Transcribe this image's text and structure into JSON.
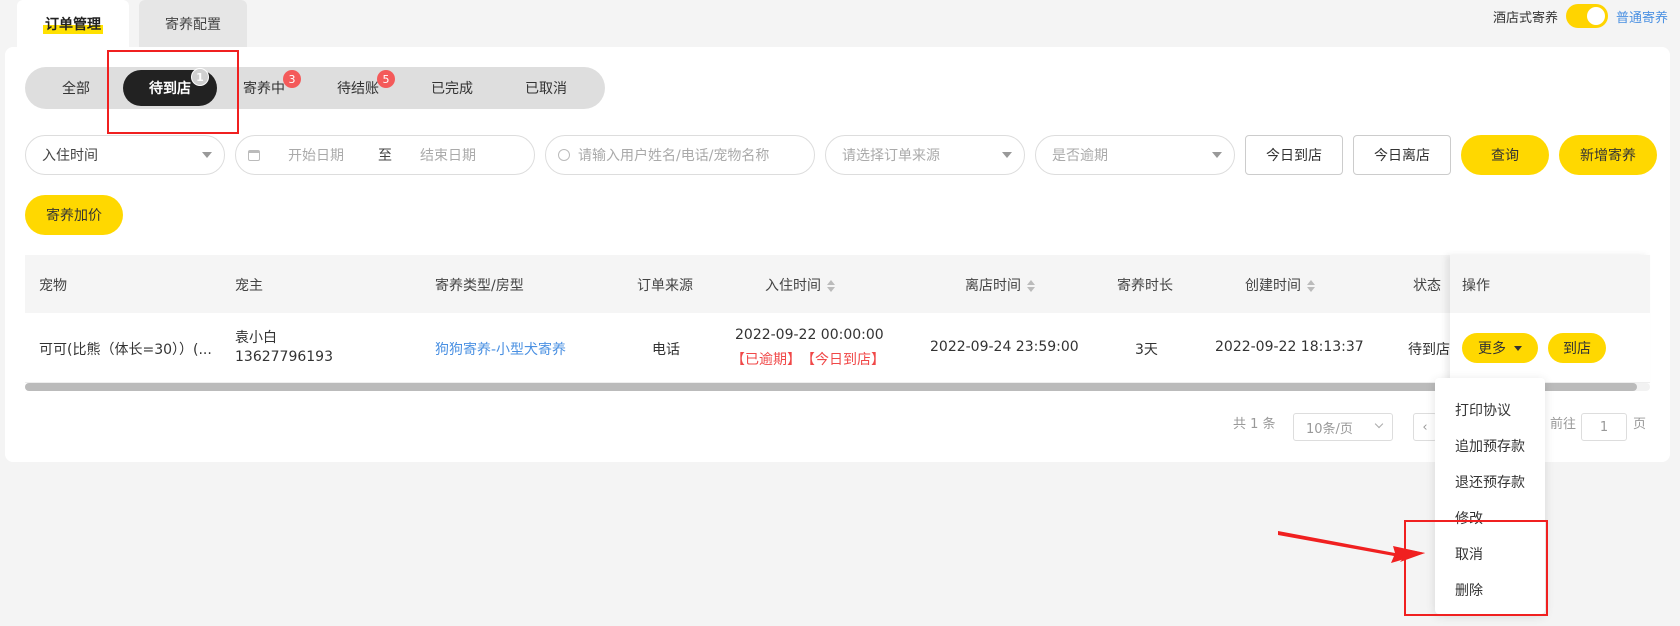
{
  "top_tabs": [
    {
      "label": "订单管理"
    },
    {
      "label": "寄养配置"
    }
  ],
  "mode_switch": {
    "left_label": "酒店式寄养",
    "right_label": "普通寄养"
  },
  "status_tabs": [
    {
      "label": "全部"
    },
    {
      "label": "待到店",
      "badge": "1"
    },
    {
      "label": "寄养中",
      "badge": "3"
    },
    {
      "label": "待结账",
      "badge": "5"
    },
    {
      "label": "已完成"
    },
    {
      "label": "已取消"
    }
  ],
  "filters": {
    "time_type": "入住时间",
    "start_date_placeholder": "开始日期",
    "range_sep": "至",
    "end_date_placeholder": "结束日期",
    "search_placeholder": "请输入用户姓名/电话/宠物名称",
    "source_placeholder": "请选择订单来源",
    "overdue_placeholder": "是否逾期",
    "today_arrive": "今日到店",
    "today_leave": "今日离店",
    "query": "查询",
    "add": "新增寄养",
    "price_add": "寄养加价"
  },
  "table": {
    "headers": {
      "pet": "宠物",
      "owner": "宠主",
      "type": "寄养类型/房型",
      "source": "订单来源",
      "checkin": "入住时间",
      "checkout": "离店时间",
      "duration": "寄养时长",
      "created": "创建时间",
      "status": "状态",
      "ops": "操作"
    },
    "row": {
      "pet": "可可(比熊（体长=30））(...",
      "owner_name": "袁小白",
      "owner_phone": "13627796193",
      "type": "狗狗寄养-小型犬寄养",
      "source": "电话",
      "checkin": "2022-09-22 00:00:00",
      "tag_overdue": "【已逾期】",
      "tag_today": "【今日到店】",
      "checkout": "2022-09-24 23:59:00",
      "duration": "3天",
      "created": "2022-09-22 18:13:37",
      "status": "待到店",
      "more_btn": "更多",
      "arrive_btn": "到店"
    }
  },
  "pagination": {
    "total": "共 1 条",
    "page_size": "10条/页",
    "goto": "前往",
    "page": "1",
    "page_unit": "页"
  },
  "dropdown": {
    "items": [
      "打印协议",
      "追加预存款",
      "退还预存款",
      "修改",
      "取消",
      "删除"
    ]
  },
  "colors": {
    "accent": "#ffd800",
    "badge": "#f45a5a",
    "link": "#4a90e2",
    "annotation": "#f02020"
  }
}
